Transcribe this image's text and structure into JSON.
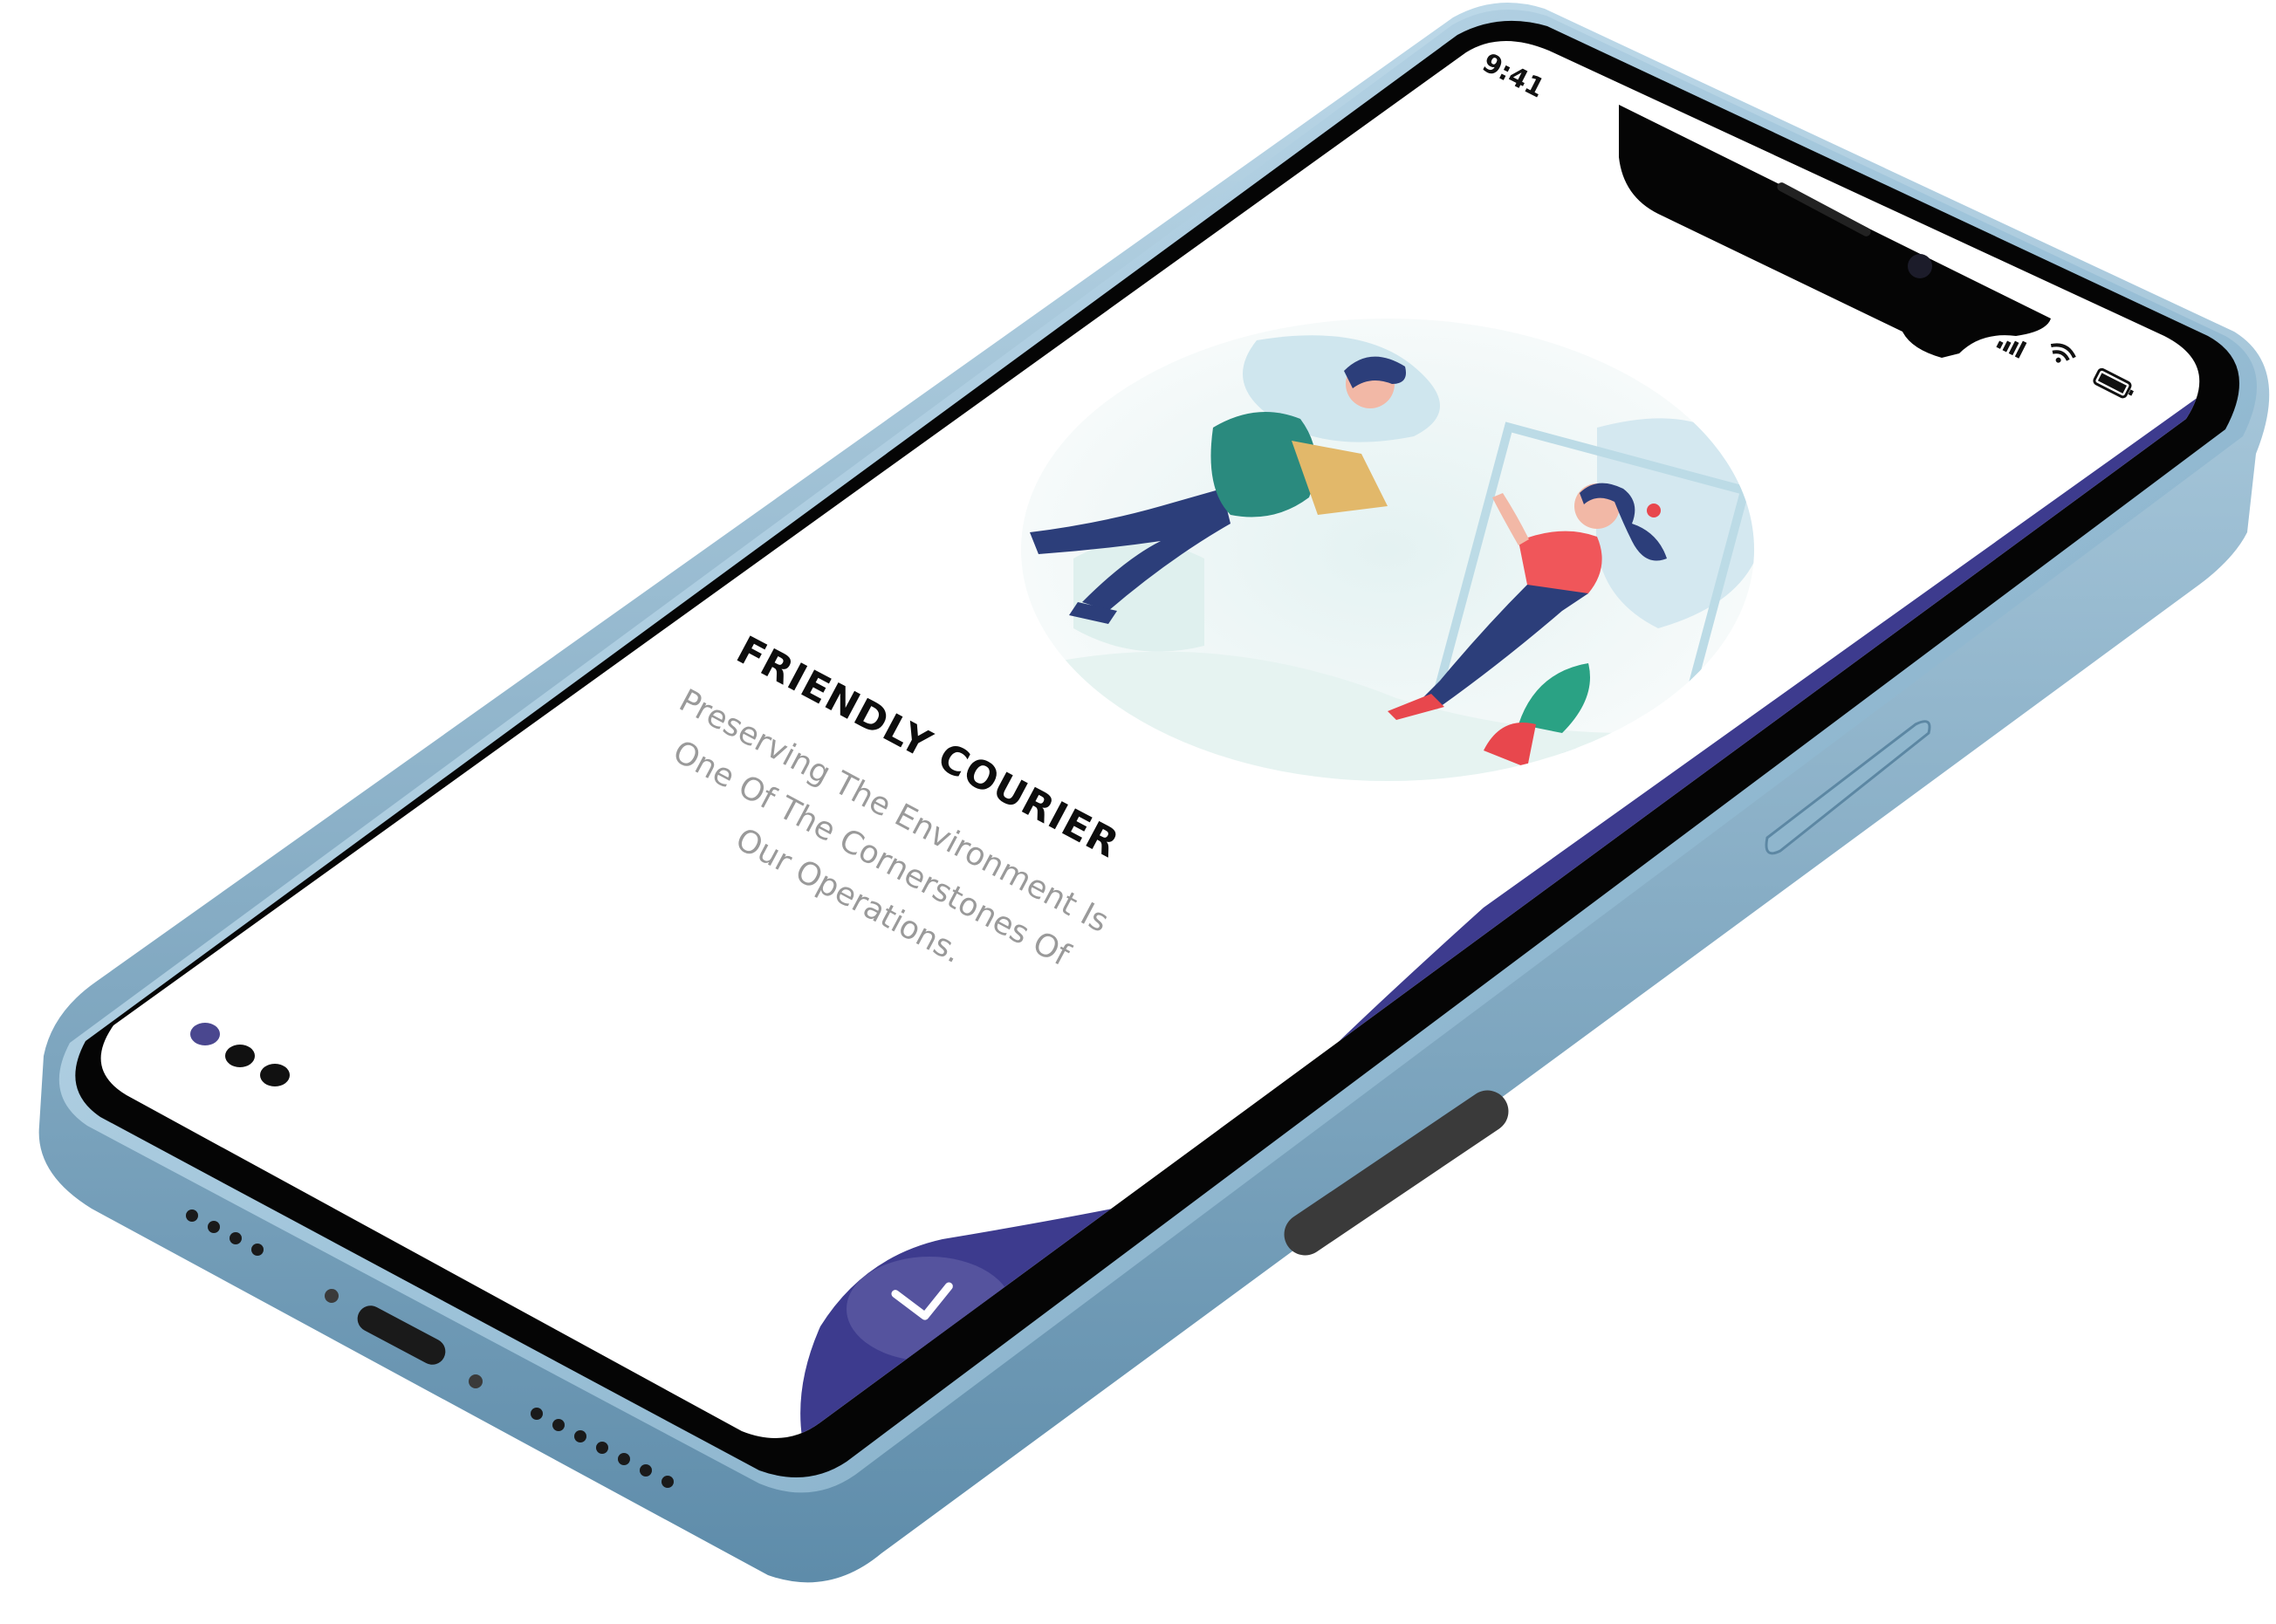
{
  "status_bar": {
    "time": "9:41",
    "signal_icon": "cellular-signal-icon",
    "wifi_icon": "wifi-icon",
    "battery_icon": "battery-icon"
  },
  "onboarding": {
    "title": "FRIENDLY COURIER",
    "description_lines": [
      "Preserving The Environment Is",
      "One Of The Cornerstones Of",
      "Our Operations."
    ],
    "illustration": "courier-delivery-illustration",
    "page_indicator": {
      "total": 3,
      "active_index": 0
    },
    "next_button_icon": "chevron-down-icon"
  },
  "colors": {
    "accent": "#3d3b8e",
    "accent_light": "#55539e",
    "dot_active": "#4a478f",
    "dot_inactive": "#111111",
    "title": "#0d0d0d",
    "subtitle": "#9a9a9a",
    "frame": "#a9cbe0",
    "bezel": "#050505"
  }
}
